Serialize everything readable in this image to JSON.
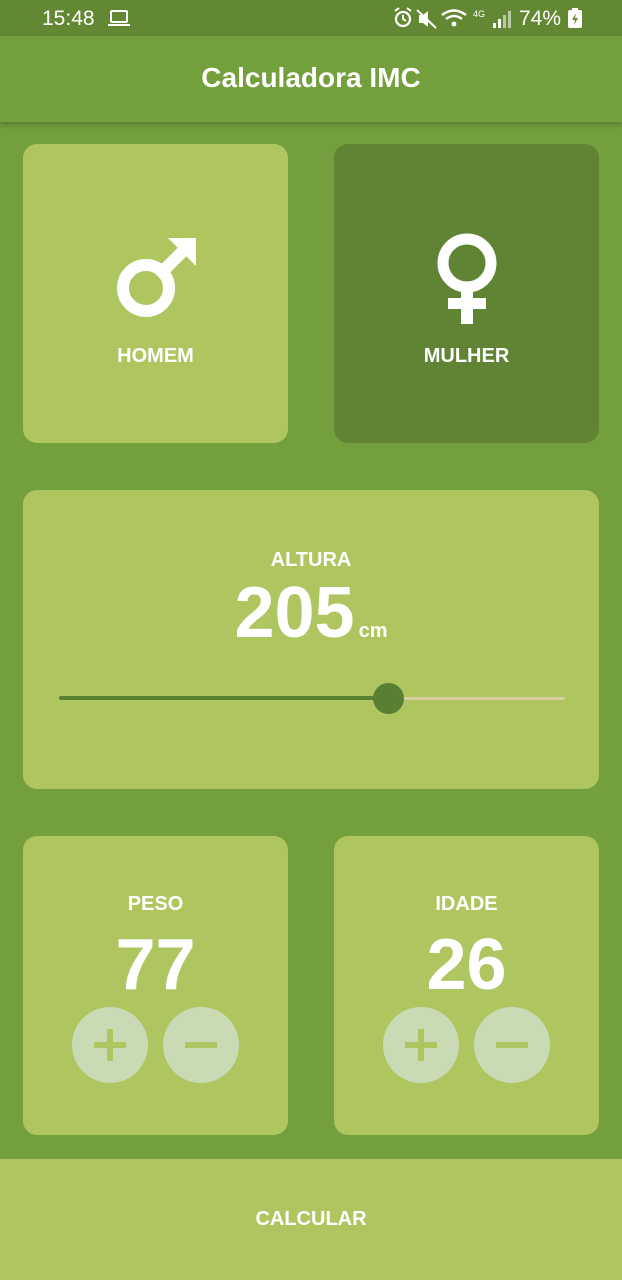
{
  "status_bar": {
    "time": "15:48",
    "battery": "74%",
    "network": "4G",
    "icons": [
      "laptop-icon",
      "alarm-icon",
      "mute-icon",
      "wifi-icon",
      "signal-icon",
      "battery-charging-icon"
    ]
  },
  "app_bar": {
    "title": "Calculadora IMC"
  },
  "gender": {
    "male": {
      "label": "HOMEM",
      "icon": "male-icon",
      "selected": false
    },
    "female": {
      "label": "MULHER",
      "icon": "female-icon",
      "selected": true
    }
  },
  "height": {
    "label": "ALTURA",
    "value": "205",
    "unit": "cm",
    "slider_fraction": 0.65
  },
  "weight": {
    "label": "PESO",
    "value": "77",
    "increment_icon": "plus-icon",
    "decrement_icon": "minus-icon"
  },
  "age": {
    "label": "IDADE",
    "value": "26",
    "increment_icon": "plus-icon",
    "decrement_icon": "minus-icon"
  },
  "calculate": {
    "label": "CALCULAR"
  },
  "colors": {
    "background": "#739f3d",
    "card": "#afc660",
    "card_selected": "#608434",
    "slider_active": "#5a7f33",
    "slider_inactive": "#d7cfa3",
    "button": "#c8dbb4",
    "text": "#ffffff"
  }
}
